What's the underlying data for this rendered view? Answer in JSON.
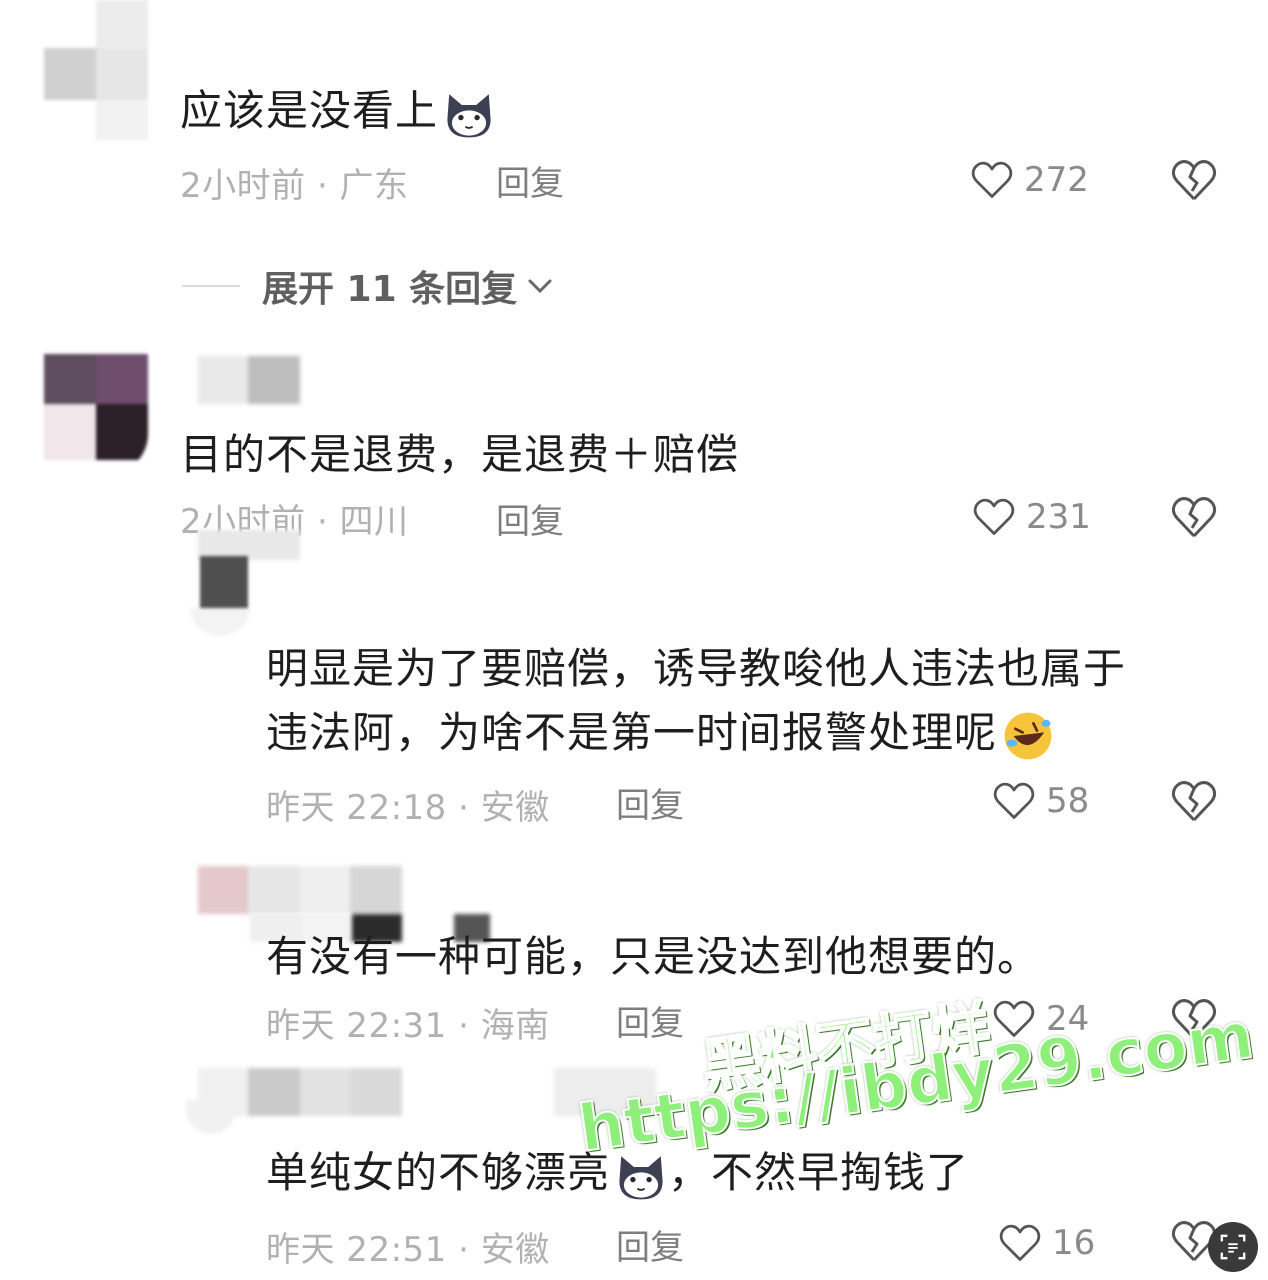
{
  "comments": [
    {
      "text": "应该是没看上",
      "emoji": "cat-face-icon",
      "meta": "2小时前 · 广东",
      "reply_label": "回复",
      "likes": "272"
    },
    {
      "text": "目的不是退费，是退费＋赔偿",
      "meta": "2小时前 · 四川",
      "reply_label": "回复",
      "likes": "231"
    }
  ],
  "expand_replies": "展开 11 条回复",
  "replies": [
    {
      "line1": "明显是为了要赔偿，诱导教唆他人违法也属于",
      "line2": "违法阿，为啥不是第一时间报警处理呢",
      "emoji": "rolling-laughing-icon",
      "meta": "昨天 22:18 · 安徽",
      "reply_label": "回复",
      "likes": "58"
    },
    {
      "text": "有没有一种可能，只是没达到他想要的。",
      "meta": "昨天 22:31 · 海南",
      "reply_label": "回复",
      "likes": "24"
    },
    {
      "text_before": "单纯女的不够漂亮",
      "emoji": "cat-face-icon",
      "text_after": "，不然早掏钱了",
      "meta": "昨天 22:51 · 安徽",
      "reply_label": "回复",
      "likes": "16"
    }
  ],
  "watermark": {
    "line1": "黑料不打烊",
    "line2": "https://ibdy29.com"
  },
  "colors": {
    "text": "#1e1e1e",
    "meta": "#b1b1b1",
    "reply": "#7e7e7e",
    "watermark": "#8ef07a"
  }
}
